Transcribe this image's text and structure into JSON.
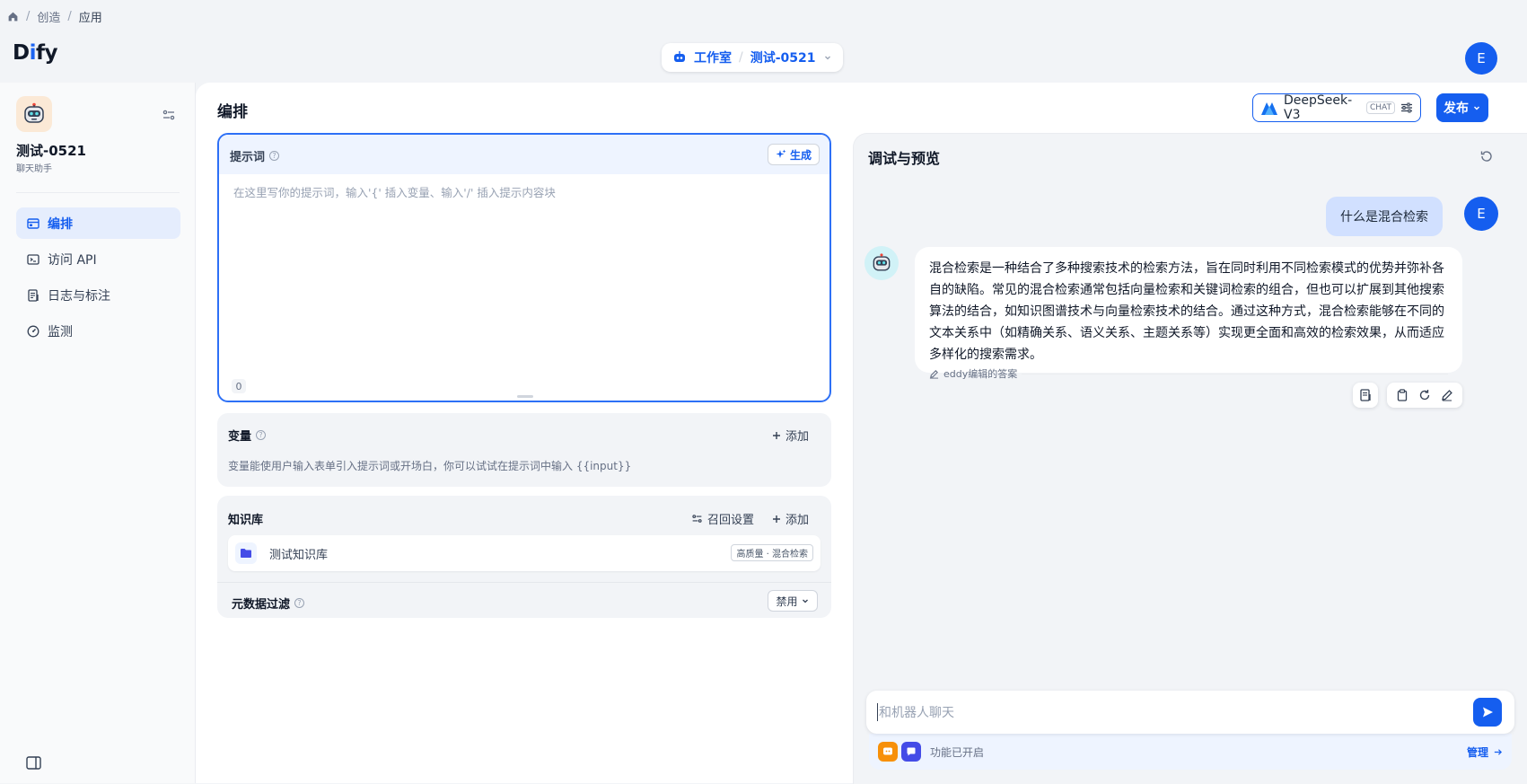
{
  "breadcrumb": {
    "items": [
      "创造",
      "应用"
    ]
  },
  "header": {
    "logo_text_a": "D",
    "logo_text_b": "i",
    "logo_text_c": "fy",
    "studio_label": "工作室",
    "app_switch_label": "测试-0521",
    "avatar_letter": "E"
  },
  "sidebar": {
    "app_name": "测试-0521",
    "app_type": "聊天助手",
    "items": [
      {
        "label": "编排",
        "icon": "layout-icon",
        "active": true
      },
      {
        "label": "访问 API",
        "icon": "terminal-icon",
        "active": false
      },
      {
        "label": "日志与标注",
        "icon": "file-list-icon",
        "active": false
      },
      {
        "label": "监测",
        "icon": "dashboard-icon",
        "active": false
      }
    ]
  },
  "main": {
    "title": "编排",
    "model_name": "DeepSeek-V3",
    "model_badge": "CHAT",
    "publish_label": "发布"
  },
  "prompt": {
    "label": "提示词",
    "generate_label": "生成",
    "placeholder": "在这里写你的提示词，输入'{' 插入变量、输入'/' 插入提示内容块",
    "char_count": "0"
  },
  "variables": {
    "label": "变量",
    "add_label": "添加",
    "description": "变量能使用户输入表单引入提示词或开场白，你可以试试在提示词中输入 {{input}}"
  },
  "knowledge": {
    "label": "知识库",
    "recall_label": "召回设置",
    "add_label": "添加",
    "item_name": "测试知识库",
    "item_tag": "高质量 · 混合检索",
    "meta_filter_label": "元数据过滤",
    "meta_filter_value": "禁用"
  },
  "debug": {
    "title": "调试与预览",
    "user_message": "什么是混合检索",
    "user_avatar": "E",
    "bot_message": "混合检索是一种结合了多种搜索技术的检索方法，旨在同时利用不同检索模式的优势并弥补各自的缺陷。常见的混合检索通常包括向量检索和关键词检索的组合，但也可以扩展到其他搜索算法的结合，如知识图谱技术与向量检索技术的结合。通过这种方式，混合检索能够在不同的文本关系中（如精确关系、语义关系、主题关系等）实现更全面和高效的检索效果，从而适应多样化的搜索需求。",
    "edited_note": "eddy编辑的答案",
    "input_placeholder": "和机器人聊天",
    "features_label": "功能已开启",
    "manage_label": "管理"
  },
  "colors": {
    "accent": "#155eef",
    "active_nav_bg": "#e5edfd",
    "panel_bg": "#f2f4f7"
  }
}
